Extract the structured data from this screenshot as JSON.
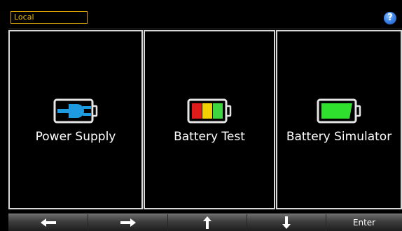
{
  "status_bar": {
    "mode_label": "Local",
    "help_icon": "question-mark-icon",
    "help_symbol": "?",
    "mode_border_color": "#d9a400",
    "help_color": "#3f86ea"
  },
  "tiles": [
    {
      "label": "Power Supply",
      "icon": "power-plug-icon"
    },
    {
      "label": "Battery Test",
      "icon": "battery-test-icon"
    },
    {
      "label": "Battery Simulator",
      "icon": "battery-simulator-icon"
    }
  ],
  "softkeys": [
    {
      "icon": "arrow-left-icon",
      "label": ""
    },
    {
      "icon": "arrow-right-icon",
      "label": ""
    },
    {
      "icon": "arrow-up-icon",
      "label": ""
    },
    {
      "icon": "arrow-down-icon",
      "label": ""
    },
    {
      "icon": "",
      "label": "Enter"
    }
  ]
}
